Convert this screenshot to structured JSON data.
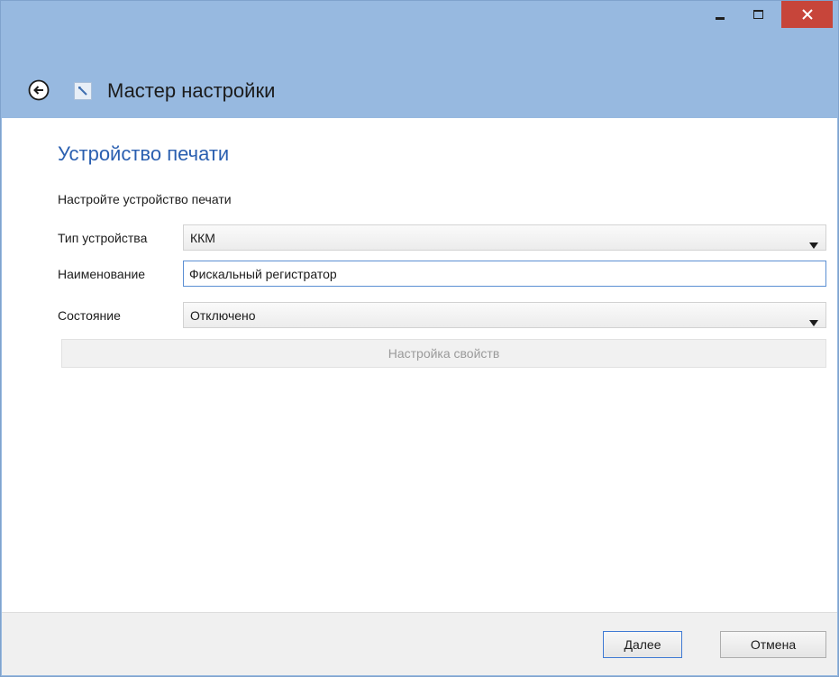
{
  "window": {
    "header_title": "Мастер настройки"
  },
  "section": {
    "title": "Устройство печати",
    "subtitle": "Настройте устройство печати"
  },
  "fields": {
    "device_type": {
      "label": "Тип устройства",
      "value": "ККМ"
    },
    "name": {
      "label": "Наименование",
      "value": "Фискальный регистратор"
    },
    "state": {
      "label": "Состояние",
      "value": "Отключено"
    }
  },
  "props_button": {
    "label": "Настройка свойств",
    "enabled": false
  },
  "footer": {
    "next_accel": "Д",
    "next_rest": "алее",
    "cancel": "Отмена"
  },
  "colors": {
    "chrome": "#97b9e0",
    "accent": "#2a5fb0",
    "close": "#c7453a"
  },
  "icons": {
    "back": "back-arrow-icon",
    "app": "wizard-icon",
    "dropdown": "triangle-down-icon",
    "minimize": "minimize-icon",
    "maximize": "maximize-icon",
    "close": "close-icon"
  }
}
